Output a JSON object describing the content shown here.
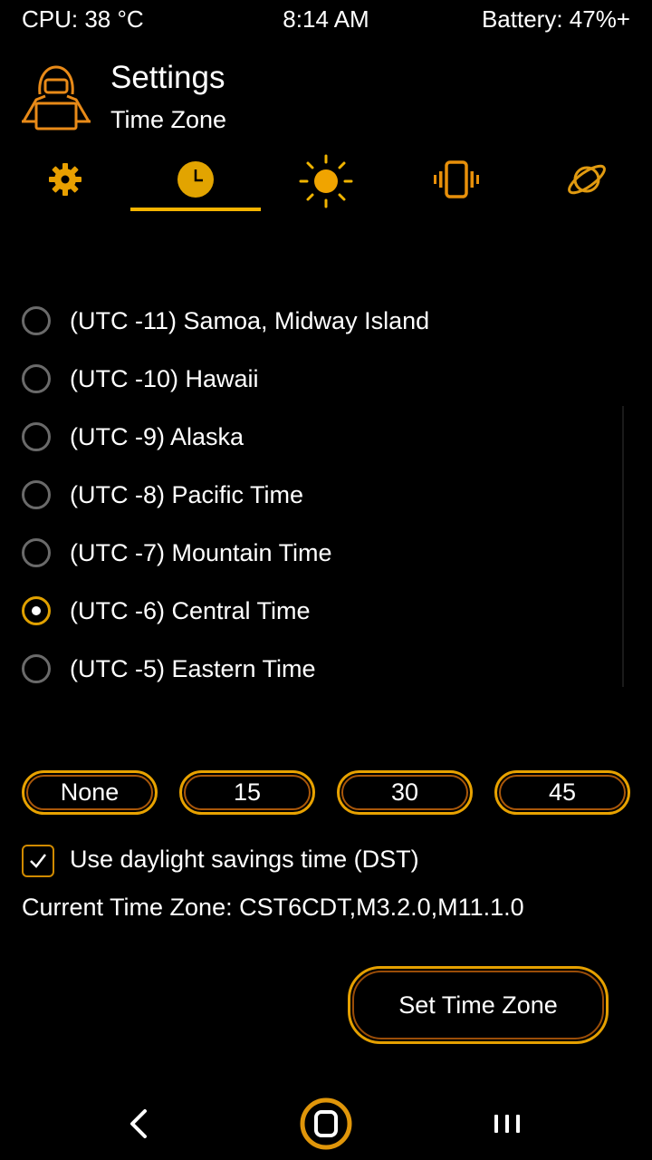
{
  "status_bar": {
    "cpu": "CPU: 38 °C",
    "time": "8:14 AM",
    "battery": "Battery: 47%+"
  },
  "header": {
    "title": "Settings",
    "subtitle": "Time Zone",
    "logo_icon": "hacker-icon"
  },
  "tabs": [
    {
      "icon": "gear-icon",
      "selected": false
    },
    {
      "icon": "clock-icon",
      "selected": true
    },
    {
      "icon": "sun-icon",
      "selected": false
    },
    {
      "icon": "vibrate-icon",
      "selected": false
    },
    {
      "icon": "planet-icon",
      "selected": false
    }
  ],
  "timezones": [
    {
      "label": "(UTC -11) Samoa, Midway Island",
      "selected": false
    },
    {
      "label": "(UTC -10) Hawaii",
      "selected": false
    },
    {
      "label": "(UTC -9) Alaska",
      "selected": false
    },
    {
      "label": "(UTC -8) Pacific Time",
      "selected": false
    },
    {
      "label": "(UTC -7) Mountain Time",
      "selected": false
    },
    {
      "label": "(UTC -6) Central Time",
      "selected": true
    },
    {
      "label": "(UTC -5) Eastern Time",
      "selected": false
    }
  ],
  "offset_buttons": [
    "None",
    "15",
    "30",
    "45"
  ],
  "dst": {
    "label": "Use daylight savings time (DST)",
    "checked": true
  },
  "current_timezone": "Current Time Zone: CST6CDT,M3.2.0,M11.1.0",
  "set_button_label": "Set Time Zone",
  "nav": [
    "back-icon",
    "home-icon",
    "recents-icon"
  ],
  "colors": {
    "accent": "#f5b400",
    "accent_dark": "#a9570a",
    "background": "#000000",
    "text": "#ffffff"
  }
}
